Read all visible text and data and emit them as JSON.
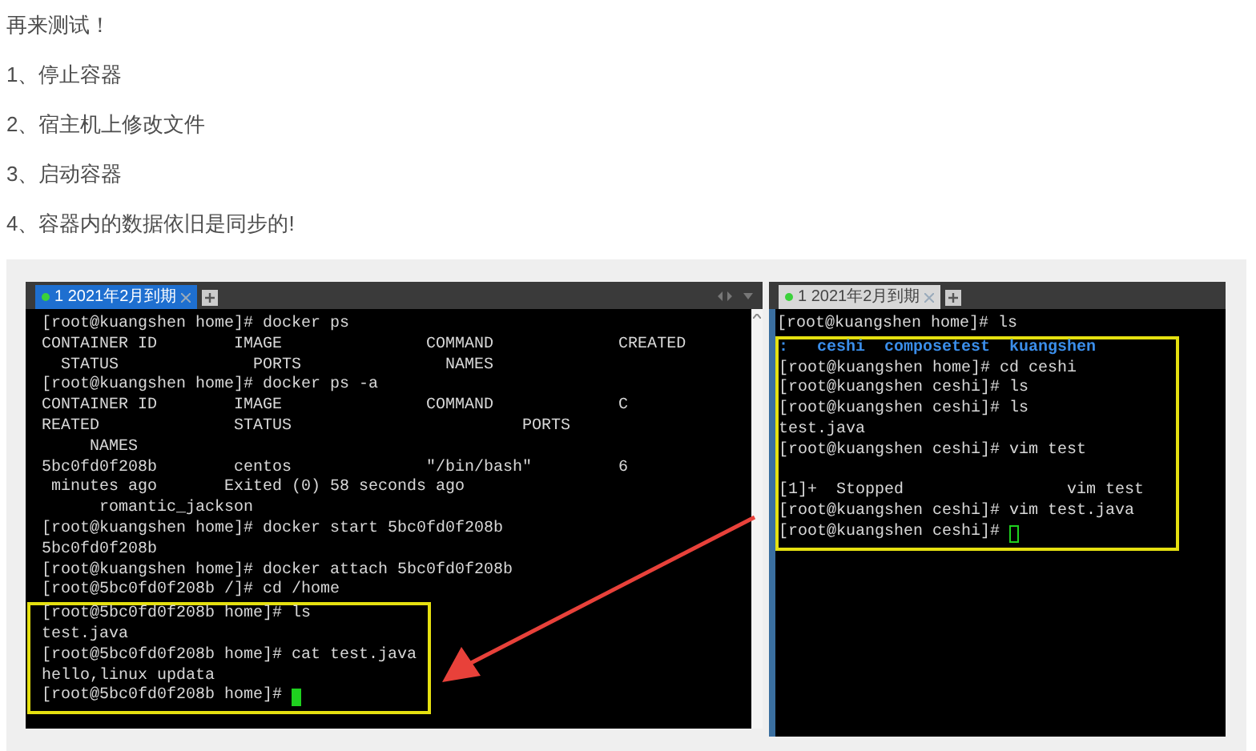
{
  "paragraphs": [
    "再来测试！",
    "1、停止容器",
    "2、宿主机上修改文件",
    "3、启动容器",
    "4、容器内的数据依旧是同步的!"
  ],
  "terminals": [
    {
      "tab": {
        "label": "1 2021年2月到期",
        "selected": true
      },
      "blocks": [
        {
          "highlighted": false,
          "lines": [
            {
              "kind": "text",
              "text": "[root@kuangshen home]# docker ps"
            },
            {
              "kind": "text",
              "text": "CONTAINER ID        IMAGE               COMMAND             CREATED"
            },
            {
              "kind": "text",
              "text": "  STATUS              PORTS               NAMES"
            },
            {
              "kind": "text",
              "text": "[root@kuangshen home]# docker ps -a"
            },
            {
              "kind": "text",
              "text": "CONTAINER ID        IMAGE               COMMAND             C"
            },
            {
              "kind": "text",
              "text": "REATED              STATUS                        PORTS"
            },
            {
              "kind": "text",
              "text": "     NAMES"
            },
            {
              "kind": "text",
              "text": "5bc0fd0f208b        centos              \"/bin/bash\"         6"
            },
            {
              "kind": "text",
              "text": " minutes ago       Exited (0) 58 seconds ago"
            },
            {
              "kind": "text",
              "text": "      romantic_jackson"
            },
            {
              "kind": "text",
              "text": "[root@kuangshen home]# docker start 5bc0fd0f208b"
            },
            {
              "kind": "text",
              "text": "5bc0fd0f208b"
            },
            {
              "kind": "text",
              "text": "[root@kuangshen home]# docker attach 5bc0fd0f208b"
            },
            {
              "kind": "text",
              "text": "[root@5bc0fd0f208b /]# cd /home"
            }
          ]
        },
        {
          "highlighted": true,
          "lines": [
            {
              "kind": "text",
              "text": "[root@5bc0fd0f208b home]# ls"
            },
            {
              "kind": "text",
              "text": "test.java"
            },
            {
              "kind": "text",
              "text": "[root@5bc0fd0f208b home]# cat test.java"
            },
            {
              "kind": "text",
              "text": "hello,linux updata"
            },
            {
              "kind": "cursorline",
              "text": "[root@5bc0fd0f208b home]#",
              "cursor_filled": true
            }
          ]
        }
      ]
    },
    {
      "tab": {
        "label": "1 2021年2月到期",
        "selected": false
      },
      "blocks": [
        {
          "highlighted": false,
          "lines": [
            {
              "kind": "text",
              "text": "[root@kuangshen home]# ls"
            }
          ]
        },
        {
          "highlighted": true,
          "lines": [
            {
              "kind": "listing",
              "text": ":   ceshi  composetest  kuangshen"
            },
            {
              "kind": "text",
              "text": "[root@kuangshen home]# cd ceshi"
            },
            {
              "kind": "text",
              "text": "[root@kuangshen ceshi]# ls"
            },
            {
              "kind": "text",
              "text": "[root@kuangshen ceshi]# ls"
            },
            {
              "kind": "text",
              "text": "test.java"
            },
            {
              "kind": "text",
              "text": "[root@kuangshen ceshi]# vim test"
            },
            {
              "kind": "blank"
            },
            {
              "kind": "text",
              "text": "[1]+  Stopped                 vim test"
            },
            {
              "kind": "text",
              "text": "[root@kuangshen ceshi]# vim test.java"
            },
            {
              "kind": "cursorline",
              "text": "[root@kuangshen ceshi]#",
              "cursor_filled": false
            }
          ]
        }
      ]
    }
  ],
  "annotation_arrow": true
}
